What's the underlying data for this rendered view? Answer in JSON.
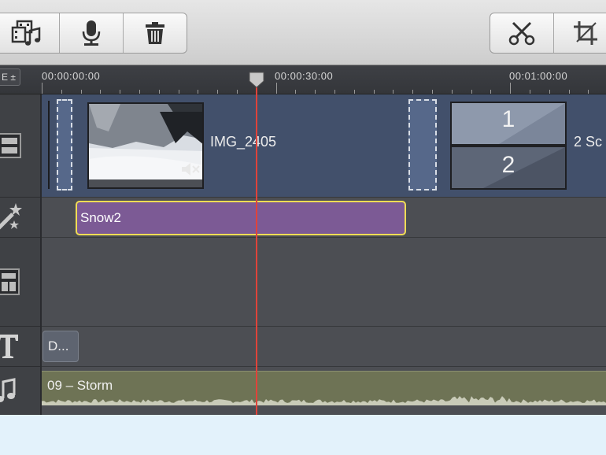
{
  "toolbar": {
    "left_buttons": [
      {
        "icon": "media-import-icon"
      },
      {
        "icon": "microphone-icon"
      },
      {
        "icon": "trash-icon"
      }
    ],
    "right_buttons": [
      {
        "icon": "scissors-icon"
      },
      {
        "icon": "crop-icon"
      }
    ]
  },
  "ruler": {
    "control_label": "E ±",
    "timecodes": [
      "00:00:00:00",
      "00:00:30:00",
      "00:01:00:00"
    ]
  },
  "tracks": {
    "video": {
      "clip1_label": "IMG_2405",
      "clip2_top": "1",
      "clip2_bottom": "2",
      "clip2_label": "2 Sc"
    },
    "effects": {
      "clip_label": "Snow2"
    },
    "text": {
      "clip_label": "D..."
    },
    "audio": {
      "clip_label": "09 – Storm"
    }
  },
  "colors": {
    "playhead": "#e0433a",
    "effect_clip": "#7c5a95",
    "effect_border": "#f0dc55",
    "audio_clip": "#6e7355",
    "video_lane": "#43516d"
  }
}
